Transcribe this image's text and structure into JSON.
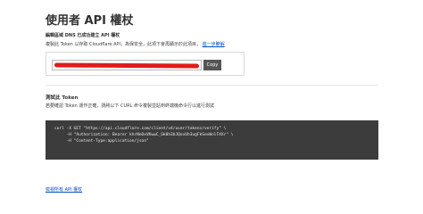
{
  "page": {
    "title": "使用者 API 權杖"
  },
  "token_section": {
    "success_message": "編輯區域 DNS 已成功建立 API 權杖",
    "info_text": "複製此 Token 以存取 Cloudflare API，為保安全，此項下會再顯示於此項目，",
    "learn_more_link": "進一步瞭解",
    "copy_label": "Copy"
  },
  "test_section": {
    "heading": "測試此 Token",
    "description": "若要確認 Token 運作正確，請將以下 CURL 命令複製並貼到終端機命令行以進行測試",
    "code_lines": [
      "curl -X GET \"https://api.cloudflare.com/client/v4/user/tokens/verify\" \\",
      "     -H \"Authorization: Bearer khrNeOxVKwwC_Gk0h3bJQovUh3ugFkSexWnlFXXr\" \\",
      "     -H \"Content-Type:application/json\""
    ]
  },
  "footer": {
    "view_all_link": "檢視所有 API 權杖"
  }
}
